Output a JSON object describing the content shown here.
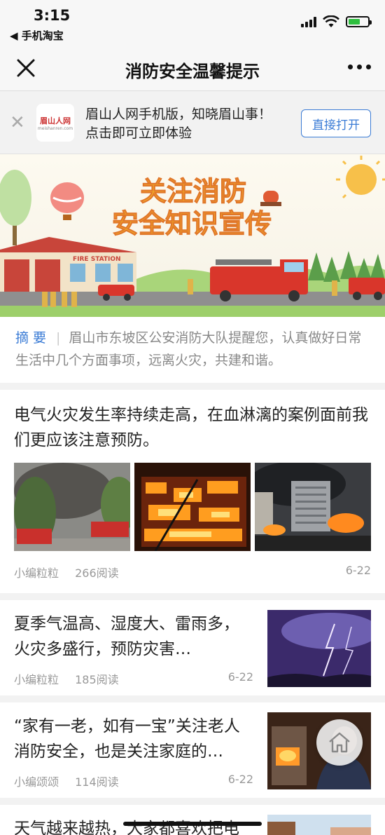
{
  "status_bar": {
    "time": "3:15",
    "back_app": "◀ 手机淘宝"
  },
  "nav": {
    "title": "消防安全温馨提示"
  },
  "app_banner": {
    "logo_text": "眉山人网",
    "logo_sub": "meishanren.com",
    "line1": "眉山人网手机版，知晓眉山事！",
    "line2": "点击即可立即体验",
    "open_button": "直接打开"
  },
  "hero": {
    "headline_1": "关注消防",
    "headline_2": "安全知识宣传",
    "station_sign": "FIRE STATION"
  },
  "summary": {
    "label": "摘要",
    "text": "眉山市东坡区公安消防大队提醒您，认真做好日常生活中几个方面事项，远离火灾，共建和谐。"
  },
  "articles": [
    {
      "title": "电气火灾发生率持续走高，在血淋漓的案例面前我们更应该注意预防。",
      "author": "小编粒粒",
      "reads": "266阅读",
      "date": "6-22"
    },
    {
      "title": "夏季气温高、湿度大、雷雨多，火灾多盛行，预防灾害…",
      "author": "小编粒粒",
      "reads": "185阅读",
      "date": "6-22"
    },
    {
      "title": "“家有一老，如有一宝”关注老人消防安全，也是关注家庭的…",
      "author": "小编颂颂",
      "reads": "114阅读",
      "date": "6-22"
    },
    {
      "title": "天气越来越热，大家都喜欢把电动车停在阴凉的楼道底下",
      "author": "",
      "reads": "",
      "date": ""
    }
  ],
  "colors": {
    "accent": "#3a7bd5",
    "meta": "#999999",
    "divider": "#f2f2f2"
  }
}
